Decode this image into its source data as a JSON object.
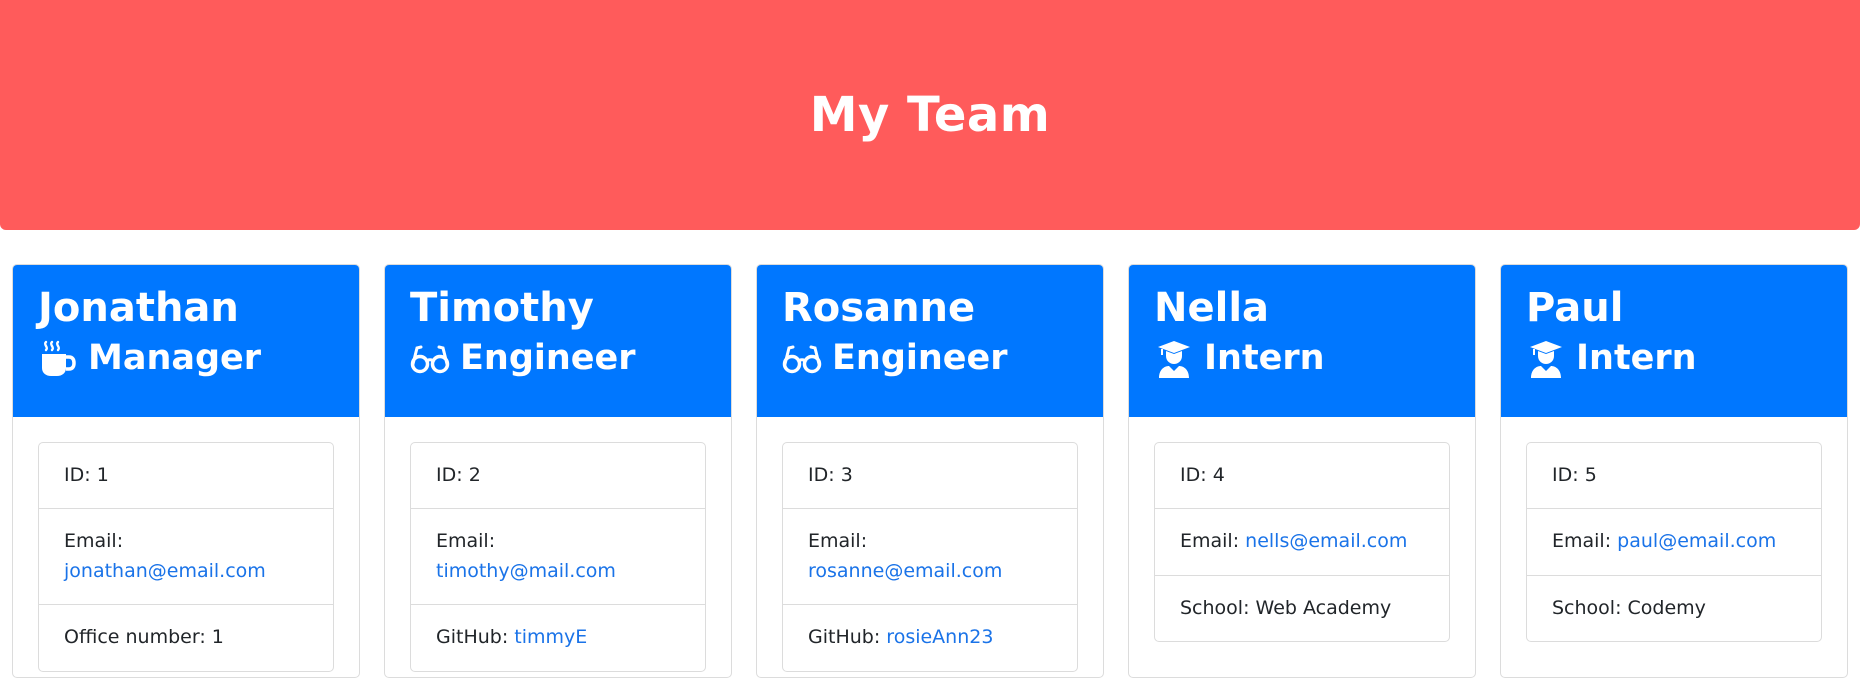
{
  "header": {
    "title": "My Team",
    "background_color": "#ff5b5b"
  },
  "accent_color": "#0077ff",
  "link_color": "#1a73e8",
  "members": [
    {
      "name": "Jonathan",
      "role": "Manager",
      "role_icon": "coffee-mug-icon",
      "id_label": "ID:",
      "id": "1",
      "email_label": "Email:",
      "email": "jonathan@email.com",
      "extra_label": "Office number:",
      "extra_value": "1"
    },
    {
      "name": "Timothy",
      "role": "Engineer",
      "role_icon": "glasses-icon",
      "id_label": "ID:",
      "id": "2",
      "email_label": "Email:",
      "email": "timothy@mail.com",
      "extra_label": "GitHub:",
      "extra_value": "timmyE"
    },
    {
      "name": "Rosanne",
      "role": "Engineer",
      "role_icon": "glasses-icon",
      "id_label": "ID:",
      "id": "3",
      "email_label": "Email:",
      "email": "rosanne@email.com",
      "extra_label": "GitHub:",
      "extra_value": "rosieAnn23"
    },
    {
      "name": "Nella",
      "role": "Intern",
      "role_icon": "graduate-icon",
      "id_label": "ID:",
      "id": "4",
      "email_label": "Email:",
      "email": "nells@email.com",
      "extra_label": "School:",
      "extra_value": "Web Academy"
    },
    {
      "name": "Paul",
      "role": "Intern",
      "role_icon": "graduate-icon",
      "id_label": "ID:",
      "id": "5",
      "email_label": "Email:",
      "email": "paul@email.com",
      "extra_label": "School:",
      "extra_value": "Codemy"
    }
  ]
}
